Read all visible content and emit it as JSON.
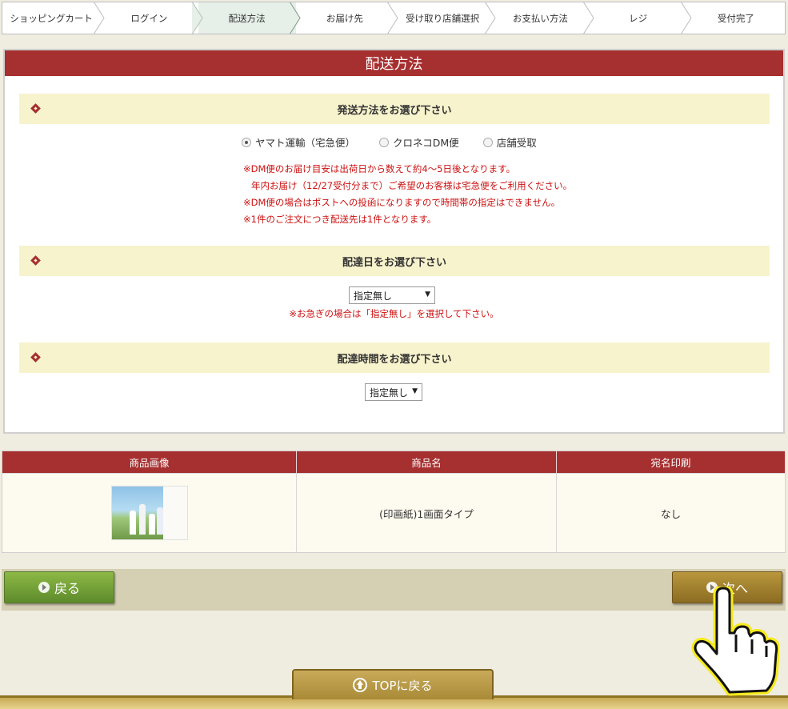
{
  "steps": {
    "items": [
      "ショッピングカート",
      "ログイン",
      "配送方法",
      "お届け先",
      "受け取り店舗選択",
      "お支払い方法",
      "レジ",
      "受付完了"
    ],
    "active_index": 2
  },
  "panel": {
    "title": "配送方法",
    "method_section": {
      "heading": "発送方法をお選び下さい",
      "options": [
        "ヤマト運輸（宅急便）",
        "クロネコDM便",
        "店舗受取"
      ],
      "selected": "ヤマト運輸（宅急便）",
      "notes": [
        "※DM便のお届け目安は出荷日から数えて約4〜5日後となります。",
        "年内お届け（12/27受付分まで）ご希望のお客様は宅急便をご利用ください。",
        "※DM便の場合はポストへの投函になりますので時間帯の指定はできません。",
        "※1件のご注文につき配送先は1件となります。"
      ]
    },
    "date_section": {
      "heading": "配達日をお選び下さい",
      "selected": "指定無し",
      "hint": "※お急ぎの場合は「指定無し」を選択して下さい。"
    },
    "time_section": {
      "heading": "配達時間をお選び下さい",
      "selected": "指定無し"
    }
  },
  "products": {
    "headers": [
      "商品画像",
      "商品名",
      "宛名印刷"
    ],
    "rows": [
      {
        "name": "(印画紙)1画面タイプ",
        "address_print": "なし"
      }
    ]
  },
  "actions": {
    "back_label": "戻る",
    "next_label": "次へ"
  },
  "footer": {
    "top_label": "TOPに戻る"
  },
  "colors": {
    "accent_red": "#a62f2f",
    "section_bg": "#f7f3cd",
    "note_red": "#cc1111",
    "back_green": "#6e9a35",
    "next_gold": "#a0812e"
  }
}
